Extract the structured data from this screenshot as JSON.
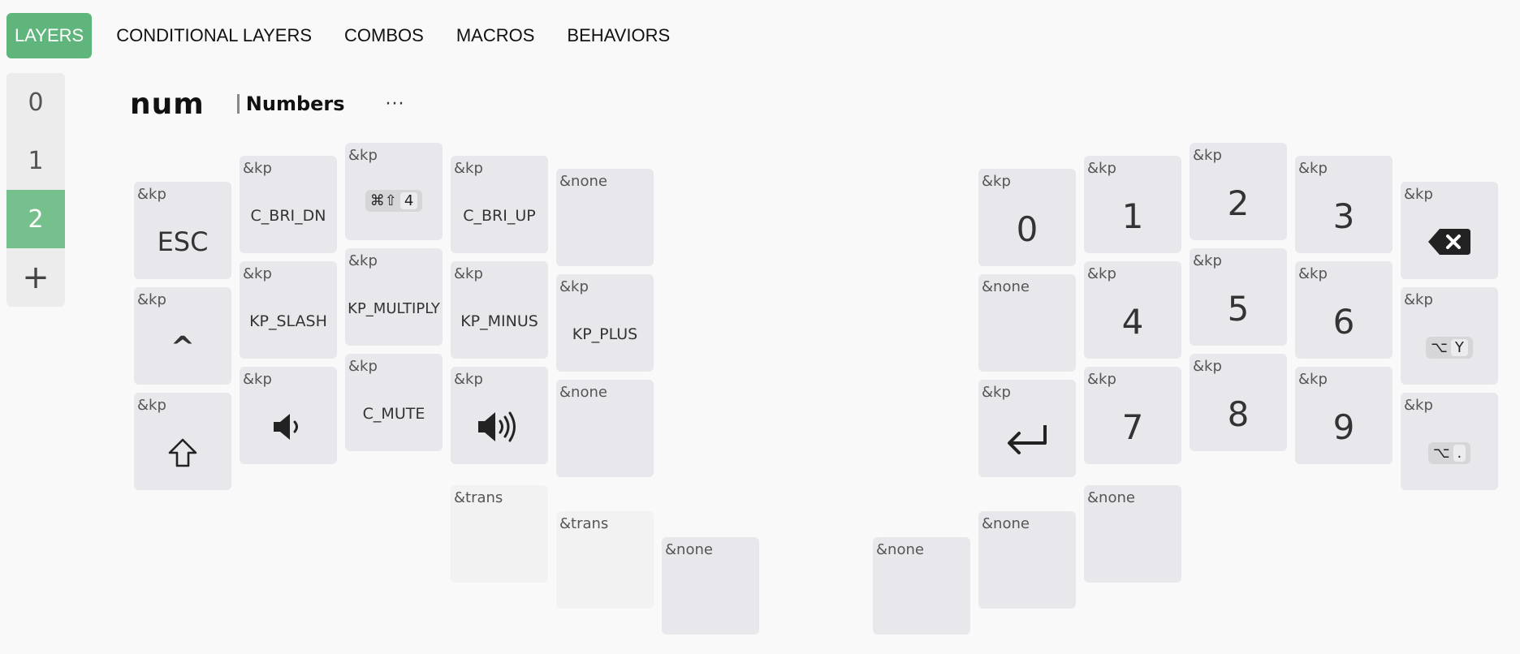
{
  "tabs": [
    {
      "label": "LAYERS",
      "active": true
    },
    {
      "label": "CONDITIONAL LAYERS"
    },
    {
      "label": "COMBOS"
    },
    {
      "label": "MACROS"
    },
    {
      "label": "BEHAVIORS"
    }
  ],
  "layers": [
    "0",
    "1",
    "2"
  ],
  "active_layer": "2",
  "add_layer_label": "+",
  "header": {
    "name": "num",
    "description": "Numbers",
    "more": "···"
  },
  "keys": [
    {
      "beh": "&kp",
      "label": "ESC"
    },
    {
      "beh": "&kp",
      "label": "^"
    },
    {
      "beh": "&kp",
      "label": "shift-icon"
    },
    {
      "beh": "&kp",
      "label": "C_BRI_DN"
    },
    {
      "beh": "&kp",
      "label": "KP_SLASH"
    },
    {
      "beh": "&kp",
      "label": "volume-down-icon"
    },
    {
      "beh": "&kp",
      "combo_mods": "⌘⇧",
      "label": "4"
    },
    {
      "beh": "&kp",
      "label": "KP_MULTIPLY"
    },
    {
      "beh": "&kp",
      "label": "C_MUTE"
    },
    {
      "beh": "&kp",
      "label": "C_BRI_UP"
    },
    {
      "beh": "&kp",
      "label": "KP_MINUS"
    },
    {
      "beh": "&kp",
      "label": "volume-up-icon"
    },
    {
      "beh": "&trans",
      "label": ""
    },
    {
      "beh": "&none",
      "label": ""
    },
    {
      "beh": "&kp",
      "label": "KP_PLUS"
    },
    {
      "beh": "&none",
      "label": ""
    },
    {
      "beh": "&trans",
      "label": ""
    },
    {
      "beh": "&none",
      "label": ""
    },
    {
      "beh": "&none",
      "label": ""
    },
    {
      "beh": "&kp",
      "label": "0"
    },
    {
      "beh": "&none",
      "label": ""
    },
    {
      "beh": "&kp",
      "label": "enter-icon"
    },
    {
      "beh": "&none",
      "label": ""
    },
    {
      "beh": "&kp",
      "label": "1"
    },
    {
      "beh": "&kp",
      "label": "4"
    },
    {
      "beh": "&kp",
      "label": "7"
    },
    {
      "beh": "&none",
      "label": ""
    },
    {
      "beh": "&kp",
      "label": "2"
    },
    {
      "beh": "&kp",
      "label": "5"
    },
    {
      "beh": "&kp",
      "label": "8"
    },
    {
      "beh": "&kp",
      "label": "3"
    },
    {
      "beh": "&kp",
      "label": "6"
    },
    {
      "beh": "&kp",
      "label": "9"
    },
    {
      "beh": "&kp",
      "label": "backspace-icon"
    },
    {
      "beh": "&kp",
      "combo_mods": "⌥",
      "label": "Y"
    },
    {
      "beh": "&kp",
      "combo_mods": "⌥",
      "label": "."
    }
  ]
}
